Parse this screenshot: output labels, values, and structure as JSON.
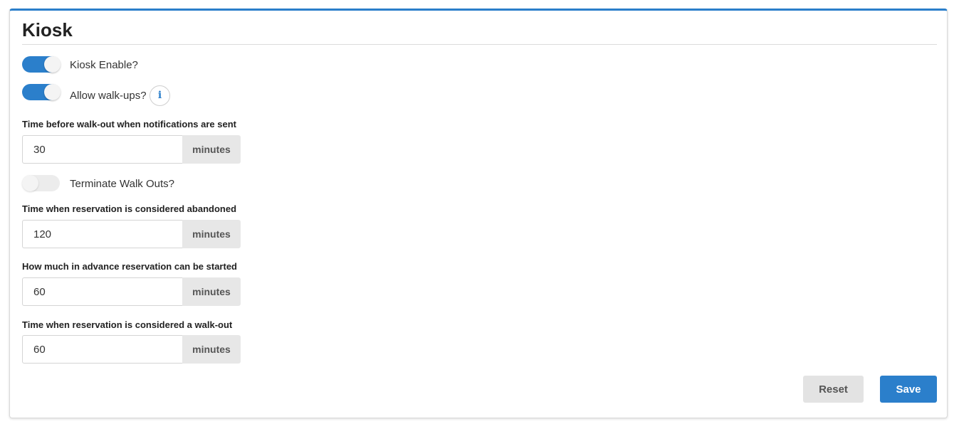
{
  "panel": {
    "title": "Kiosk"
  },
  "toggles": [
    {
      "label": "Kiosk Enable?",
      "state": "on"
    },
    {
      "label": "Allow walk-ups?",
      "state": "on",
      "info_icon": "i"
    },
    {
      "label": "Terminate Walk Outs?",
      "state": "off"
    }
  ],
  "fields": [
    {
      "label": "Time before walk-out when notifications are sent",
      "value": "30",
      "unit": "minutes"
    },
    {
      "label": "Time when reservation is considered abandoned",
      "value": "120",
      "unit": "minutes"
    },
    {
      "label": "How much in advance reservation can be started",
      "value": "60",
      "unit": "minutes"
    },
    {
      "label": "Time when reservation is considered a walk-out",
      "value": "60",
      "unit": "minutes"
    }
  ],
  "actions": {
    "reset_label": "Reset",
    "save_label": "Save"
  },
  "colors": {
    "accent": "#2b7fcb",
    "toggle_off": "#ececec",
    "addon_bg": "#e7e7e7"
  }
}
